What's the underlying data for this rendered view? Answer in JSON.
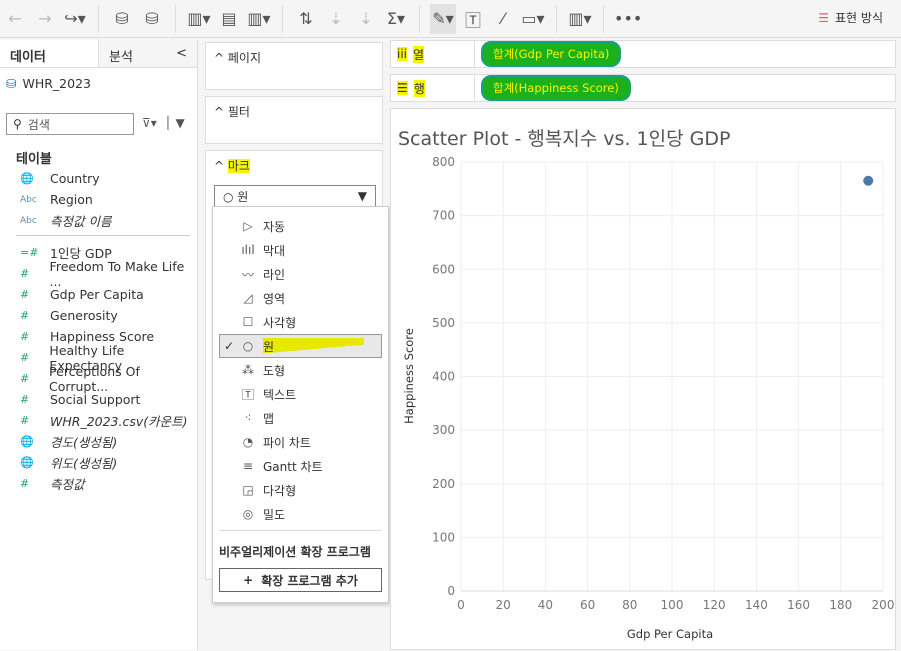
{
  "toolbar": {
    "show_me": "표현 방식"
  },
  "data_pane": {
    "tab_data": "데이터",
    "tab_analysis": "분석",
    "collapse": "<",
    "datasource": "WHR_2023",
    "search_placeholder": "검색",
    "section": "테이블",
    "fields": [
      {
        "icon": "globe",
        "label": "Country",
        "italic": false
      },
      {
        "icon": "abc",
        "label": "Region",
        "italic": false
      },
      {
        "icon": "abc",
        "label": "측정값 이름",
        "italic": true
      },
      {
        "icon": "calc-measure",
        "label": "1인당 GDP",
        "italic": false,
        "divider_before": true
      },
      {
        "icon": "measure",
        "label": "Freedom To Make Life ...",
        "italic": false
      },
      {
        "icon": "measure",
        "label": "Gdp Per Capita",
        "italic": false
      },
      {
        "icon": "measure",
        "label": "Generosity",
        "italic": false
      },
      {
        "icon": "measure",
        "label": "Happiness Score",
        "italic": false
      },
      {
        "icon": "measure",
        "label": "Healthy Life Expectancy",
        "italic": false
      },
      {
        "icon": "measure",
        "label": "Perceptions Of Corrupt...",
        "italic": false
      },
      {
        "icon": "measure",
        "label": "Social Support",
        "italic": false
      },
      {
        "icon": "measure",
        "label": "WHR_2023.csv(카운트)",
        "italic": true
      },
      {
        "icon": "globe",
        "label": "경도(생성됨)",
        "italic": true
      },
      {
        "icon": "globe",
        "label": "위도(생성됨)",
        "italic": true
      },
      {
        "icon": "measure",
        "label": "측정값",
        "italic": true
      }
    ]
  },
  "cards": {
    "pages": "페이지",
    "filters": "필터",
    "marks": "마크",
    "mark_type": "원"
  },
  "mark_menu": {
    "items": [
      {
        "icon": "▷",
        "label": "자동"
      },
      {
        "icon": "ılıl",
        "label": "막대"
      },
      {
        "icon": "〰",
        "label": "라인"
      },
      {
        "icon": "◿",
        "label": "영역"
      },
      {
        "icon": "☐",
        "label": "사각형"
      },
      {
        "icon": "○",
        "label": "원",
        "selected": true
      },
      {
        "icon": "⁂",
        "label": "도형"
      },
      {
        "icon": "🅃",
        "label": "텍스트"
      },
      {
        "icon": "⁖",
        "label": "맵"
      },
      {
        "icon": "◔",
        "label": "파이 차트"
      },
      {
        "icon": "≡",
        "label": "Gantt 차트"
      },
      {
        "icon": "◲",
        "label": "다각형"
      },
      {
        "icon": "◎",
        "label": "밀도"
      }
    ],
    "extensions_heading": "비주얼리제이션 확장 프로그램",
    "add_extension": "확장 프로그램 추가"
  },
  "shelves": {
    "columns_label": "열",
    "columns_pill": "합계(Gdp Per Capita)",
    "rows_label": "행",
    "rows_pill": "합계(Happiness Score)"
  },
  "chart_data": {
    "type": "scatter",
    "title_prefix": "Scatter Plot - ",
    "title_main": "행복지수 vs. 1인당 GDP",
    "xlabel": "Gdp Per Capita",
    "ylabel": "Happiness Score",
    "xlim": [
      0,
      200
    ],
    "ylim": [
      0,
      800
    ],
    "xticks": [
      0,
      20,
      40,
      60,
      80,
      100,
      120,
      140,
      160,
      180,
      200
    ],
    "yticks": [
      0,
      100,
      200,
      300,
      400,
      500,
      600,
      700,
      800
    ],
    "grid": true,
    "color": "#4e79a7",
    "points": [
      {
        "x": 193,
        "y": 765
      }
    ]
  }
}
